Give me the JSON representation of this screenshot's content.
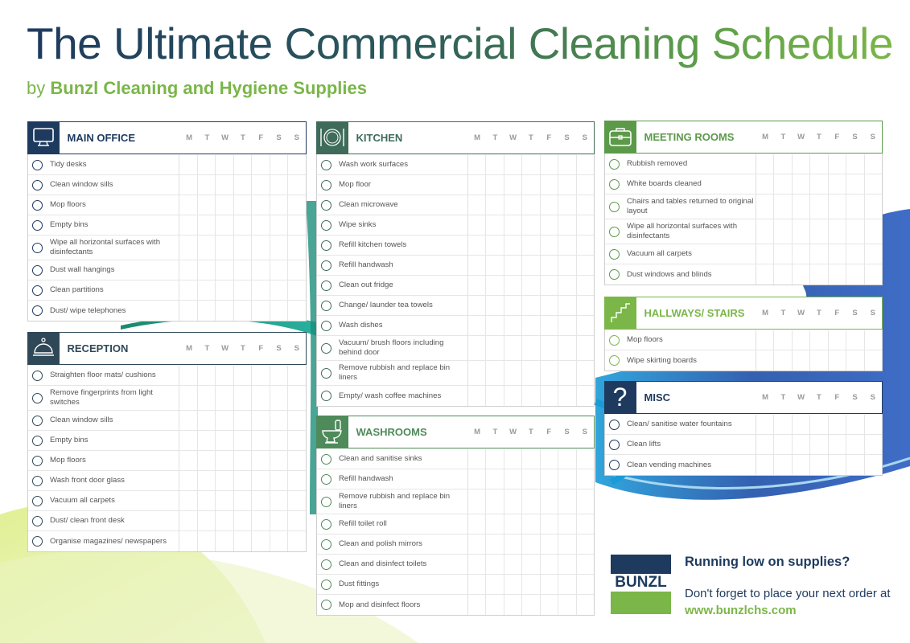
{
  "header": {
    "title": "The Ultimate Commercial Cleaning Schedule",
    "subtitle_by": "by",
    "subtitle_company": "Bunzl Cleaning and Hygiene Supplies"
  },
  "days": [
    "M",
    "T",
    "W",
    "T",
    "F",
    "S",
    "S"
  ],
  "colors": {
    "navy": "#1e3a5f",
    "slate": "#2f4858",
    "teal_green": "#3e6b5a",
    "forest_green": "#4e8a5a",
    "green": "#5c9a4a",
    "lime": "#7ab648"
  },
  "sections": {
    "main_office": {
      "title": "MAIN OFFICE",
      "icon": "monitor-icon",
      "tasks": [
        "Tidy desks",
        "Clean window sills",
        "Mop floors",
        "Empty bins",
        "Wipe all horizontal surfaces with disinfectants",
        "Dust wall hangings",
        "Clean partitions",
        "Dust/ wipe telephones"
      ]
    },
    "reception": {
      "title": "RECEPTION",
      "icon": "service-bell-icon",
      "tasks": [
        "Straighten floor mats/ cushions",
        "Remove fingerprints from light switches",
        "Clean window sills",
        "Empty bins",
        "Mop floors",
        "Wash front door glass",
        "Vacuum all carpets",
        "Dust/ clean front desk",
        "Organise magazines/ newspapers"
      ]
    },
    "kitchen": {
      "title": "KITCHEN",
      "icon": "plate-cutlery-icon",
      "tasks": [
        "Wash work surfaces",
        "Mop floor",
        "Clean microwave",
        "Wipe sinks",
        "Refill kitchen towels",
        "Refill handwash",
        "Clean out fridge",
        "Change/ launder tea towels",
        "Wash dishes",
        "Vacuum/ brush floors including behind door",
        "Remove rubbish and replace bin liners",
        "Empty/ wash coffee machines"
      ]
    },
    "washrooms": {
      "title": "WASHROOMS",
      "icon": "toilet-icon",
      "tasks": [
        "Clean and sanitise sinks",
        "Refill handwash",
        "Remove rubbish and replace bin liners",
        "Refill toilet roll",
        "Clean and polish mirrors",
        "Clean and disinfect toilets",
        "Dust fittings",
        "Mop and disinfect floors"
      ]
    },
    "meeting_rooms": {
      "title": "MEETING ROOMS",
      "icon": "briefcase-icon",
      "tasks": [
        "Rubbish removed",
        "White boards cleaned",
        "Chairs and tables returned to original layout",
        "Wipe all horizontal surfaces with disinfectants",
        "Vacuum all carpets",
        "Dust windows and blinds"
      ]
    },
    "hallways": {
      "title": "HALLWAYS/ STAIRS",
      "icon": "stairs-icon",
      "tasks": [
        "Mop floors",
        "Wipe skirting boards"
      ]
    },
    "misc": {
      "title": "MISC",
      "icon": "question-mark-icon",
      "tasks": [
        "Clean/ sanitise water fountains",
        "Clean lifts",
        "Clean vending machines"
      ]
    }
  },
  "promo": {
    "logo_text": "BUNZL",
    "heading": "Running low on supplies?",
    "body_prefix": "Don't forget to place your next order at",
    "url": "www.bunzlchs.com"
  }
}
